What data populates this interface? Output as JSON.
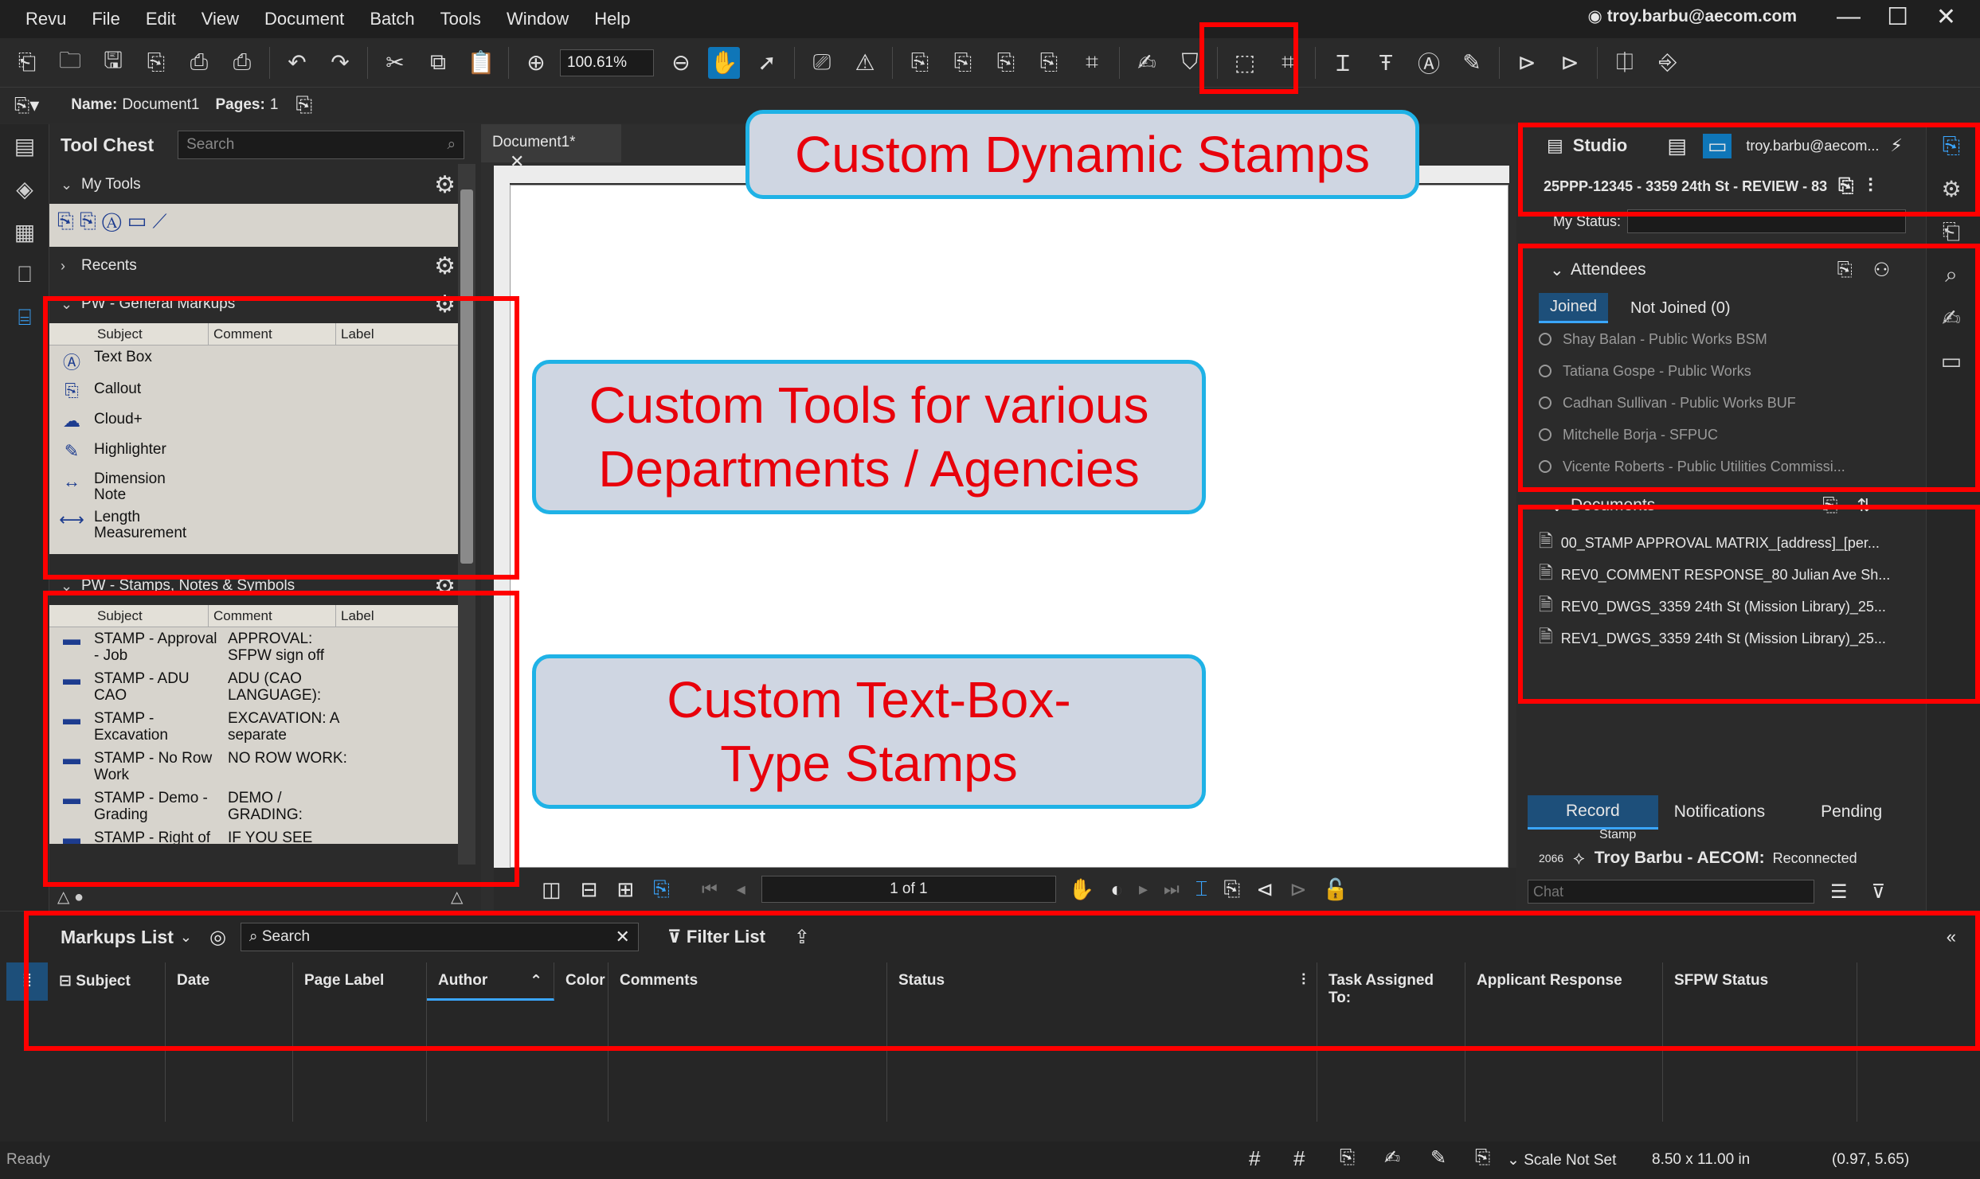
{
  "menu": [
    "Revu",
    "File",
    "Edit",
    "View",
    "Document",
    "Batch",
    "Tools",
    "Window",
    "Help"
  ],
  "user": "troy.barbu@aecom.com",
  "toolbar": {
    "zoom": "100.61%"
  },
  "docbar": {
    "name_label": "Name:",
    "name_value": "Document1",
    "pages_label": "Pages:",
    "pages_value": "1"
  },
  "toolchest": {
    "title": "Tool Chest",
    "search_placeholder": "Search",
    "my_tools": "My Tools",
    "recents": "Recents",
    "general": {
      "title": "PW - General Markups",
      "columns": [
        "Subject",
        "Comment",
        "Label"
      ],
      "items": [
        "Text Box",
        "Callout",
        "Cloud+",
        "Highlighter",
        "Dimension Note",
        "Length Measurement"
      ]
    },
    "stamps": {
      "title": "PW - Stamps, Notes & Symbols",
      "columns": [
        "Subject",
        "Comment",
        "Label"
      ],
      "items": [
        {
          "subject": "STAMP - Approval - Job",
          "comment": "APPROVAL: SFPW sign off"
        },
        {
          "subject": "STAMP - ADU CAO",
          "comment": "ADU (CAO LANGUAGE):"
        },
        {
          "subject": "STAMP - Excavation",
          "comment": "EXCAVATION: A separate"
        },
        {
          "subject": "STAMP - No Row Work",
          "comment": "NO ROW WORK:"
        },
        {
          "subject": "STAMP - Demo - Grading",
          "comment": "DEMO / GRADING:"
        },
        {
          "subject": "STAMP - Right of Way",
          "comment": "IF YOU SEE RIGHT-OF-WAY"
        }
      ]
    }
  },
  "document": {
    "tab": "Document1*",
    "page_indicator": "1 of 1"
  },
  "studio": {
    "title": "Studio",
    "user_short": "troy.barbu@aecom...",
    "session": "25PPP-12345 - 3359 24th St - REVIEW - 83",
    "my_status_label": "My Status:",
    "attendees_title": "Attendees",
    "tab_joined": "Joined",
    "tab_not_joined": "Not Joined (0)",
    "attendees": [
      "Shay Balan - Public Works BSM",
      "Tatiana Gospe - Public Works",
      "Cadhan Sullivan - Public Works BUF",
      "Mitchelle Borja - SFPUC",
      "Vicente Roberts - Public Utilities Commissi..."
    ],
    "documents_title": "Documents",
    "documents": [
      "00_STAMP APPROVAL MATRIX_[address]_[per...",
      "REV0_COMMENT RESPONSE_80 Julian Ave Sh...",
      "REV0_DWGS_3359 24th St (Mission Library)_25...",
      "REV1_DWGS_3359 24th St (Mission Library)_25..."
    ],
    "record_tabs": [
      "Record",
      "Notifications",
      "Pending"
    ],
    "record_stamp": "Stamp",
    "record_id": "2066",
    "record_user": "Troy Barbu - AECOM:",
    "record_status": "Reconnected",
    "chat_placeholder": "Chat"
  },
  "markups": {
    "title": "Markups List",
    "search_placeholder": "Search",
    "filter": "Filter List",
    "columns": [
      "Subject",
      "Date",
      "Page Label",
      "Author",
      "Color",
      "Comments",
      "Status",
      "Task Assigned To:",
      "Applicant Response",
      "SFPW Status"
    ]
  },
  "statusbar": {
    "ready": "Ready",
    "scale": "Scale Not Set",
    "size": "8.50 x 11.00 in",
    "coords": "(0.97, 5.65)"
  },
  "callouts": {
    "dynamic_stamps": "Custom Dynamic Stamps",
    "tools": "Custom Tools for various Departments / Agencies",
    "textbox_stamps": "Custom Text-Box-Type Stamps"
  },
  "colors": {
    "accent": "#0f76b8",
    "annotation_red": "#ff0000",
    "callout_border": "#1fb2e6",
    "callout_text": "#e8000b"
  }
}
